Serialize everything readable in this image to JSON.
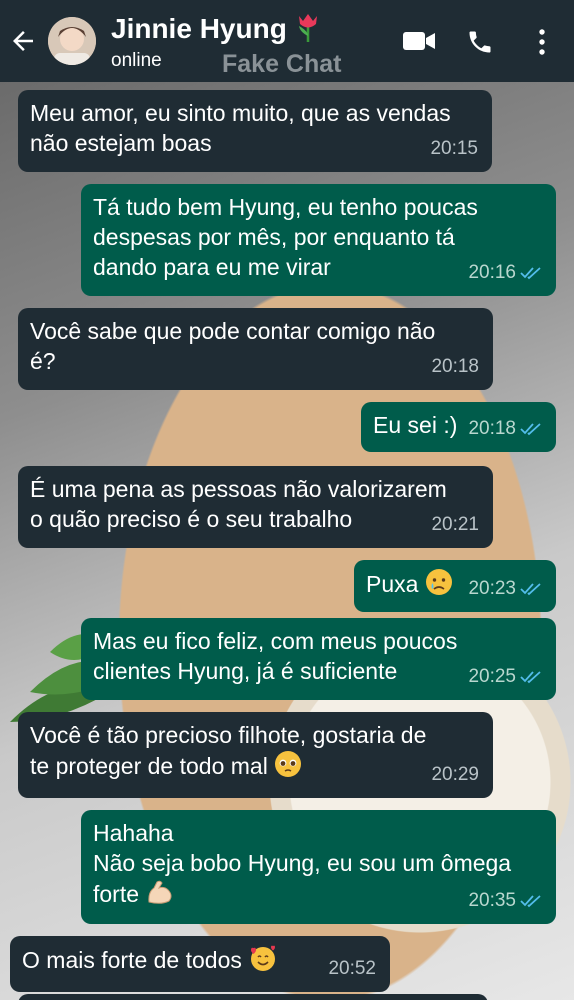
{
  "header": {
    "contact_name": "Jinnie Hyung",
    "status": "online",
    "watermark": "Fake Chat"
  },
  "messages": [
    {
      "dir": "in",
      "lines": [
        "Meu amor, eu sinto muito, que as vendas",
        "não estejam boas"
      ],
      "time": "20:15"
    },
    {
      "dir": "out",
      "lines": [
        "Tá tudo bem Hyung, eu tenho poucas",
        "despesas por mês, por enquanto tá",
        "dando para eu me virar"
      ],
      "time": "20:16",
      "ticks": "read"
    },
    {
      "dir": "in",
      "lines": [
        "Você sabe que pode contar comigo não",
        "é?"
      ],
      "time": "20:18"
    },
    {
      "dir": "out",
      "lines": [
        "Eu sei :)"
      ],
      "time": "20:18",
      "ticks": "read"
    },
    {
      "dir": "in",
      "lines": [
        "É uma pena as pessoas não valorizarem",
        "o quão preciso é o seu trabalho"
      ],
      "time": "20:21"
    },
    {
      "dir": "out",
      "lines": [
        "Puxa"
      ],
      "emoji": "crying-face",
      "time": "20:23",
      "ticks": "read"
    },
    {
      "dir": "out",
      "lines": [
        "Mas eu fico feliz, com meus poucos",
        "clientes Hyung, já é suficiente"
      ],
      "time": "20:25",
      "ticks": "read"
    },
    {
      "dir": "in",
      "lines": [
        "Você é tão precioso filhote, gostaria de",
        "te proteger de todo mal"
      ],
      "emoji": "pleading-face",
      "time": "20:29"
    },
    {
      "dir": "out",
      "lines": [
        "Hahaha",
        "Não seja bobo Hyung, eu sou um ômega",
        "forte"
      ],
      "emoji": "flexed-biceps",
      "time": "20:35",
      "ticks": "read"
    },
    {
      "dir": "in",
      "lines": [
        "O mais forte de todos"
      ],
      "emoji": "smiling-face-with-hearts",
      "time": "20:52"
    }
  ],
  "colors": {
    "header": "#1f2c34",
    "incoming": "#1f2c34",
    "outgoing": "#005c4b",
    "read_ticks": "#53bdeb"
  }
}
